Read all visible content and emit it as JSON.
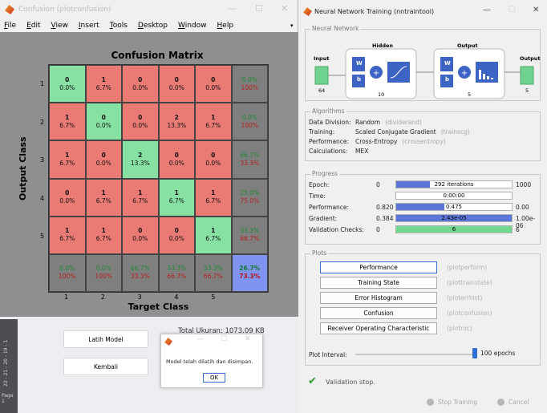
{
  "confusion_window": {
    "title": "Confusion (plotconfusion)",
    "menu": [
      "File",
      "Edit",
      "View",
      "Insert",
      "Tools",
      "Desktop",
      "Window",
      "Help"
    ],
    "chart_title": "Confusion Matrix",
    "ylabel": "Output Class",
    "xlabel": "Target Class",
    "row_labels": [
      "1",
      "2",
      "3",
      "4",
      "5"
    ],
    "col_labels": [
      "1",
      "2",
      "3",
      "4",
      "5"
    ],
    "cells": [
      [
        {
          "n": "0",
          "p": "0.0%",
          "c": "green"
        },
        {
          "n": "1",
          "p": "6.7%",
          "c": "red"
        },
        {
          "n": "0",
          "p": "0.0%",
          "c": "red"
        },
        {
          "n": "0",
          "p": "0.0%",
          "c": "red"
        },
        {
          "n": "0",
          "p": "0.0%",
          "c": "red"
        },
        {
          "n": "0.0%",
          "p": "100%",
          "c": "gray"
        }
      ],
      [
        {
          "n": "1",
          "p": "6.7%",
          "c": "red"
        },
        {
          "n": "0",
          "p": "0.0%",
          "c": "green"
        },
        {
          "n": "0",
          "p": "0.0%",
          "c": "red"
        },
        {
          "n": "2",
          "p": "13.3%",
          "c": "red"
        },
        {
          "n": "1",
          "p": "6.7%",
          "c": "red"
        },
        {
          "n": "0.0%",
          "p": "100%",
          "c": "gray"
        }
      ],
      [
        {
          "n": "1",
          "p": "6.7%",
          "c": "red"
        },
        {
          "n": "0",
          "p": "0.0%",
          "c": "red"
        },
        {
          "n": "2",
          "p": "13.3%",
          "c": "green"
        },
        {
          "n": "0",
          "p": "0.0%",
          "c": "red"
        },
        {
          "n": "0",
          "p": "0.0%",
          "c": "red"
        },
        {
          "n": "66.7%",
          "p": "33.3%",
          "c": "gray"
        }
      ],
      [
        {
          "n": "0",
          "p": "0.0%",
          "c": "red"
        },
        {
          "n": "1",
          "p": "6.7%",
          "c": "red"
        },
        {
          "n": "1",
          "p": "6.7%",
          "c": "red"
        },
        {
          "n": "1",
          "p": "6.7%",
          "c": "green"
        },
        {
          "n": "1",
          "p": "6.7%",
          "c": "red"
        },
        {
          "n": "25.0%",
          "p": "75.0%",
          "c": "gray"
        }
      ],
      [
        {
          "n": "1",
          "p": "6.7%",
          "c": "red"
        },
        {
          "n": "1",
          "p": "6.7%",
          "c": "red"
        },
        {
          "n": "0",
          "p": "0.0%",
          "c": "red"
        },
        {
          "n": "0",
          "p": "0.0%",
          "c": "red"
        },
        {
          "n": "1",
          "p": "6.7%",
          "c": "green"
        },
        {
          "n": "33.3%",
          "p": "66.7%",
          "c": "gray"
        }
      ],
      [
        {
          "n": "0.0%",
          "p": "100%",
          "c": "gray"
        },
        {
          "n": "0.0%",
          "p": "100%",
          "c": "gray"
        },
        {
          "n": "66.7%",
          "p": "33.3%",
          "c": "gray"
        },
        {
          "n": "33.3%",
          "p": "66.7%",
          "c": "gray"
        },
        {
          "n": "33.3%",
          "p": "66.7%",
          "c": "gray"
        },
        {
          "n": "26.7%",
          "p": "73.3%",
          "c": "blue"
        }
      ]
    ]
  },
  "lower_panel": {
    "sidebar_text": "22 - 21 - 20 - 19 - 1",
    "page_label": "Page 1",
    "train_button": "Latih Model",
    "back_button": "Kembali",
    "total_size": "Total Ukuran: 1073.09 KB"
  },
  "dialog": {
    "message": "Model telah dilatih dan disimpan.",
    "ok_label": "OK"
  },
  "nntrain": {
    "title": "Neural Network Training (nntraintool)",
    "network_label": "Neural Network",
    "diagram": {
      "input_label": "Input",
      "input_size": "64",
      "hidden_label": "Hidden",
      "hidden_size": "10",
      "output_label": "Output",
      "output_layer_size": "5",
      "output_out_label": "Output",
      "output_size": "5",
      "w": "W",
      "b": "b"
    },
    "algorithms_label": "Algorithms",
    "algorithms": [
      {
        "k": "Data Division:",
        "v": "Random",
        "f": "(dividerand)"
      },
      {
        "k": "Training:",
        "v": "Scaled Conjugate Gradient",
        "f": "(trainscg)"
      },
      {
        "k": "Performance:",
        "v": "Cross-Entropy",
        "f": "(crossentropy)"
      },
      {
        "k": "Calculations:",
        "v": "MEX",
        "f": ""
      }
    ],
    "progress_label": "Progress",
    "progress": [
      {
        "k": "Epoch:",
        "start": "0",
        "val": "292 iterations",
        "end": "1000",
        "fill": 0.292
      },
      {
        "k": "Time:",
        "start": "",
        "val": "0:00:00",
        "end": "",
        "fill": 0
      },
      {
        "k": "Performance:",
        "start": "0.820",
        "val": "0.475",
        "end": "0.00",
        "fill": 0.42
      },
      {
        "k": "Gradient:",
        "start": "0.384",
        "val": "2.43e-05",
        "end": "1.00e-06",
        "fill": 1.0
      },
      {
        "k": "Validation Checks:",
        "start": "0",
        "val": "6",
        "end": "6",
        "fill": 1.0
      }
    ],
    "plots_label": "Plots",
    "plots": [
      {
        "label": "Performance",
        "fn": "(plotperform)"
      },
      {
        "label": "Training State",
        "fn": "(plottrainstate)"
      },
      {
        "label": "Error Histogram",
        "fn": "(ploterrhist)"
      },
      {
        "label": "Confusion",
        "fn": "(plotconfusion)"
      },
      {
        "label": "Receiver Operating Characteristic",
        "fn": "(plotroc)"
      }
    ],
    "plot_interval_label": "Plot Interval:",
    "plot_interval_value": "100 epochs",
    "status": "Validation stop.",
    "stop_label": "Stop Training",
    "cancel_label": "Cancel",
    "colors": {
      "bar_blue": "#5b76d6",
      "bar_green": "#72d88f",
      "check": "#2b9a2b"
    }
  }
}
